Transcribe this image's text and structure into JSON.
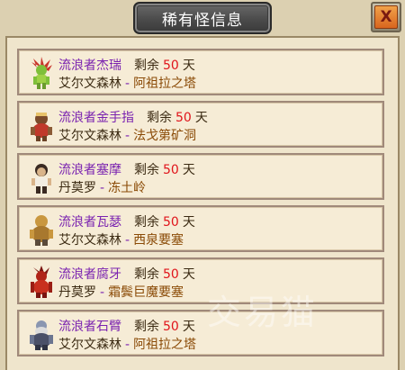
{
  "window": {
    "title": "稀有怪信息",
    "close_label": "X"
  },
  "monsters": [
    {
      "name": "流浪者杰瑞",
      "remain_label": "剩余",
      "days": "50",
      "unit": "天",
      "region": "艾尔文森林",
      "sep": "-",
      "place": "阿祖拉之塔",
      "icon": "goblin-portrait-icon"
    },
    {
      "name": "流浪者金手指",
      "remain_label": "剩余",
      "days": "50",
      "unit": "天",
      "region": "艾尔文森林",
      "sep": "-",
      "place": "法戈第矿洞",
      "icon": "kobold-portrait-icon"
    },
    {
      "name": "流浪者塞摩",
      "remain_label": "剩余",
      "days": "50",
      "unit": "天",
      "region": "丹莫罗",
      "sep": "-",
      "place": "冻土岭",
      "icon": "trogg-portrait-icon"
    },
    {
      "name": "流浪者瓦瑟",
      "remain_label": "剩余",
      "days": "50",
      "unit": "天",
      "region": "艾尔文森林",
      "sep": "-",
      "place": "西泉要塞",
      "icon": "gnoll-portrait-icon"
    },
    {
      "name": "流浪者腐牙",
      "remain_label": "剩余",
      "days": "50",
      "unit": "天",
      "region": "丹莫罗",
      "sep": "-",
      "place": "霜鬓巨魔要塞",
      "icon": "troll-portrait-icon"
    },
    {
      "name": "流浪者石臂",
      "remain_label": "剩余",
      "days": "50",
      "unit": "天",
      "region": "艾尔文森林",
      "sep": "-",
      "place": "阿祖拉之塔",
      "icon": "dwarf-portrait-icon"
    }
  ],
  "watermark": "交易猫",
  "colors": {
    "name": "#7a22b0",
    "days": "#e0141b",
    "place": "#8a4a06",
    "text": "#3b2a12"
  }
}
